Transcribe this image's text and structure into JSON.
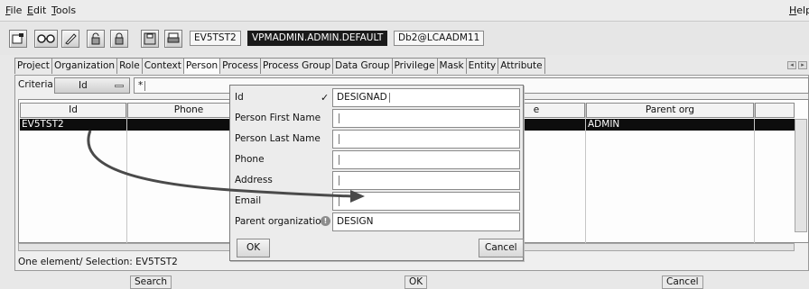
{
  "menubar": {
    "file": "File",
    "edit": "Edit",
    "tools": "Tools",
    "help": "Help"
  },
  "toolbar": {
    "icons": [
      "new-icon",
      "glasses-icon",
      "edit-icon",
      "lock-icon",
      "unlock-icon",
      "save-icon",
      "print-icon"
    ],
    "user": "EV5TST2",
    "context": "VPMADMIN.ADMIN.DEFAULT",
    "database": "Db2@LCAADM11"
  },
  "tabs": [
    "Project",
    "Organization",
    "Role",
    "Context",
    "Person",
    "Process",
    "Process Group",
    "Data Group",
    "Privilege",
    "Mask",
    "Entity",
    "Attribute"
  ],
  "active_tab": "Person",
  "criteria": {
    "label": "Criteria:",
    "field": "Id",
    "value": "*"
  },
  "table": {
    "columns": {
      "id": "Id",
      "phone": "Phone",
      "email_partial": "e",
      "parent_org": "Parent org"
    },
    "row": {
      "id": "EV5TST2",
      "parent_org": "ADMIN"
    }
  },
  "status": "One element/ Selection: EV5TST2",
  "bottom_buttons": {
    "search": "Search",
    "ok": "OK",
    "cancel": "Cancel"
  },
  "dialog": {
    "labels": {
      "id": "Id",
      "first_name": "Person First Name",
      "last_name": "Person Last Name",
      "phone": "Phone",
      "address": "Address",
      "email": "Email",
      "parent_org": "Parent organization"
    },
    "values": {
      "id": "DESIGNAD",
      "parent_org": "DESIGN"
    },
    "ok": "OK",
    "cancel": "Cancel"
  }
}
